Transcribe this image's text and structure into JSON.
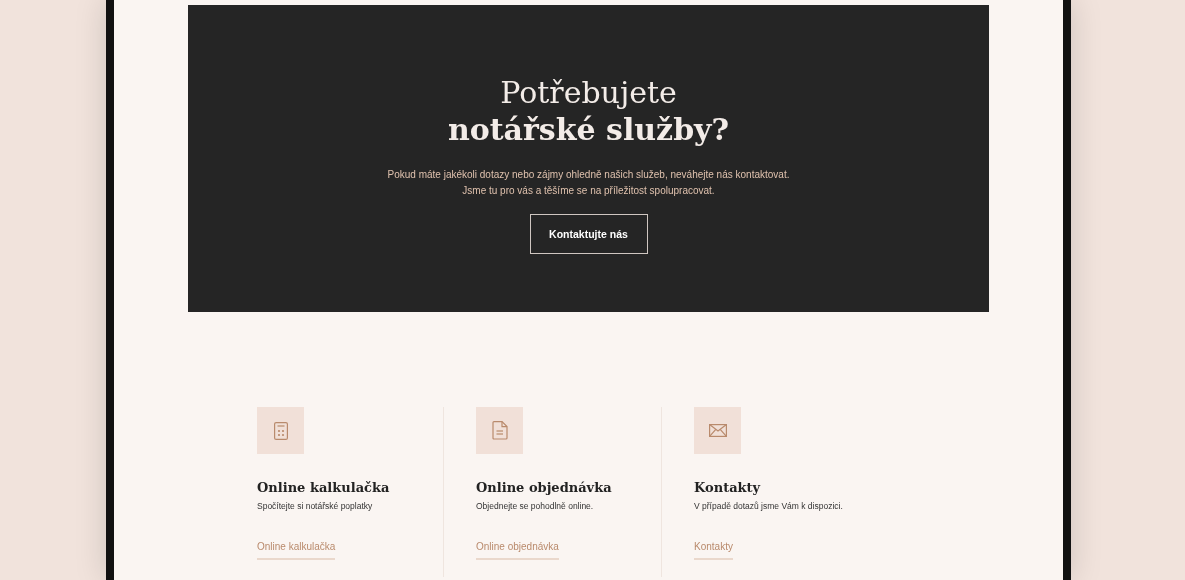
{
  "banner": {
    "title_line_1": "Potřebujete",
    "title_line_2": "notářské služby?",
    "text_lines": [
      "Pokud máte jakékoli dotazy nebo zájmy ohledně našich služeb, neváhejte nás kontaktovat.",
      "Jsme tu pro vás a těšíme se na příležitost spolupracovat."
    ],
    "button": "Kontaktujte nás"
  },
  "cards": [
    {
      "kind": "calculator",
      "title": "Online kalkulačka",
      "text": "Spočítejte si notářské poplatky",
      "link": "Online kalkulačka"
    },
    {
      "kind": "document",
      "title": "Online objednávka",
      "text": "Objednejte se pohodlně online.",
      "link": "Online objednávka"
    },
    {
      "kind": "mail",
      "title": "Kontakty",
      "text": "V případě dotazů jsme Vám k dispozici.",
      "link": "Kontakty"
    }
  ]
}
